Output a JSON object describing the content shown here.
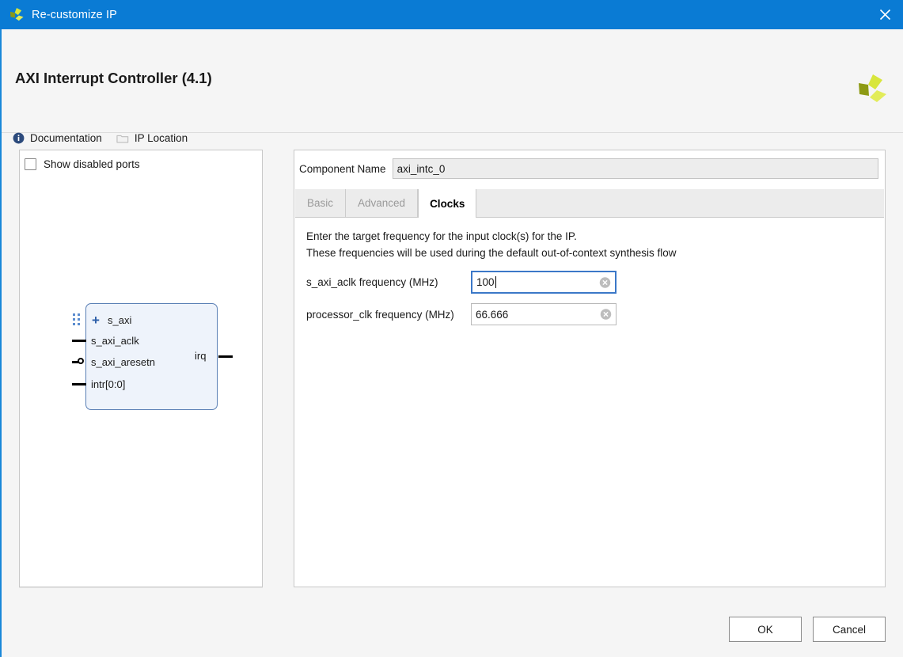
{
  "titlebar": {
    "title": "Re-customize IP",
    "logo_icon": "xilinx-logo-icon",
    "close_icon": "close-icon",
    "bg_color": "#0a7bd4"
  },
  "header": {
    "ip_title": "AXI Interrupt Controller (4.1)",
    "logo_icon": "xilinx-logo-icon",
    "toolbar": [
      {
        "label": "Documentation",
        "icon": "info-icon"
      },
      {
        "label": "IP Location",
        "icon": "folder-icon"
      }
    ]
  },
  "preview": {
    "show_disabled_ports_label": "Show disabled ports",
    "show_disabled_ports_checked": false,
    "symbol": {
      "bus_ports": [
        {
          "name": "s_axi",
          "expand_icon": "plus-icon",
          "connector": "bus-connector-icon"
        }
      ],
      "input_ports": [
        {
          "name": "s_axi_aclk",
          "type": "clock"
        },
        {
          "name": "s_axi_aresetn",
          "type": "reset-active-low"
        },
        {
          "name": "intr[0:0]",
          "type": "signal"
        }
      ],
      "output_ports": [
        {
          "name": "irq",
          "type": "signal"
        }
      ],
      "block_fill": "#eef3fb",
      "block_border": "#5a7fb5"
    }
  },
  "config": {
    "component_name_label": "Component Name",
    "component_name_value": "axi_intc_0",
    "tabs": [
      {
        "label": "Basic",
        "active": false
      },
      {
        "label": "Advanced",
        "active": false
      },
      {
        "label": "Clocks",
        "active": true
      }
    ],
    "clocks_tab": {
      "instructions": [
        "Enter the target frequency for the input clock(s) for the IP.",
        "These frequencies will be used during the default out-of-context synthesis flow"
      ],
      "fields": [
        {
          "label": "s_axi_aclk frequency (MHz)",
          "value": "100",
          "focused": true,
          "clear_icon": "clear-circle-icon"
        },
        {
          "label": "processor_clk frequency (MHz)",
          "value": "66.666",
          "focused": false,
          "clear_icon": "clear-circle-icon"
        }
      ]
    }
  },
  "footer": {
    "ok_label": "OK",
    "cancel_label": "Cancel"
  },
  "colors": {
    "accent_blue": "#0a7bd4",
    "focus_blue": "#3b78c8",
    "panel_bg": "#f5f5f5",
    "logo_light": "#d8e63c",
    "logo_dark": "#8d9a14"
  }
}
